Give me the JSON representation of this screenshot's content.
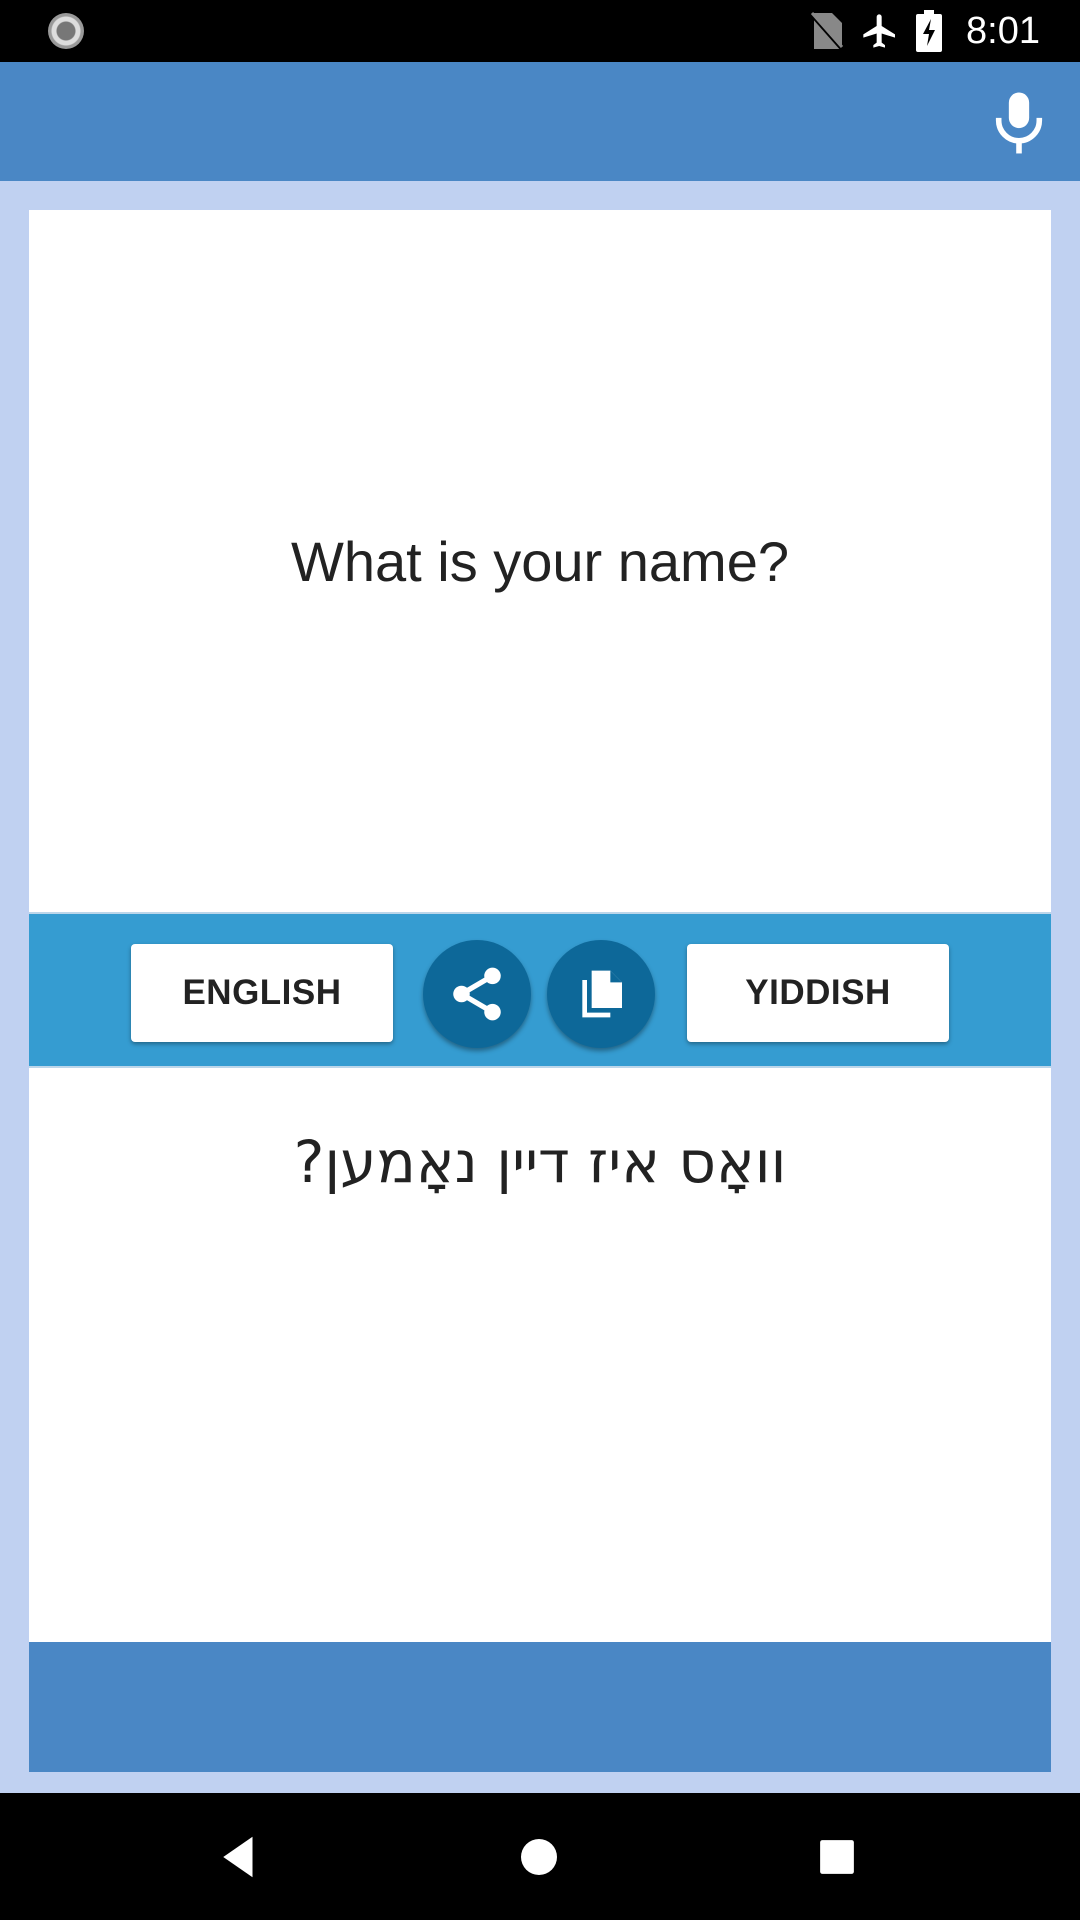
{
  "status_bar": {
    "time": "8:01",
    "icons": [
      "loading-spinner-icon",
      "no-sim-icon",
      "airplane-icon",
      "battery-charging-icon"
    ]
  },
  "app_bar": {
    "mic_icon": "microphone-icon"
  },
  "source": {
    "text": "What is your name?"
  },
  "toolbar": {
    "source_language": "ENGLISH",
    "target_language": "YIDDISH",
    "share_icon": "share-icon",
    "copy_icon": "copy-icon"
  },
  "target": {
    "text": "וואָס איז דיין נאָמען?"
  },
  "nav_bar": {
    "icons": [
      "back-icon",
      "home-icon",
      "recent-apps-icon"
    ]
  },
  "colors": {
    "app_bar": "#4a87c5",
    "background": "#c0d1f1",
    "toolbar": "#359cd1",
    "circle_button": "#0d6899"
  }
}
